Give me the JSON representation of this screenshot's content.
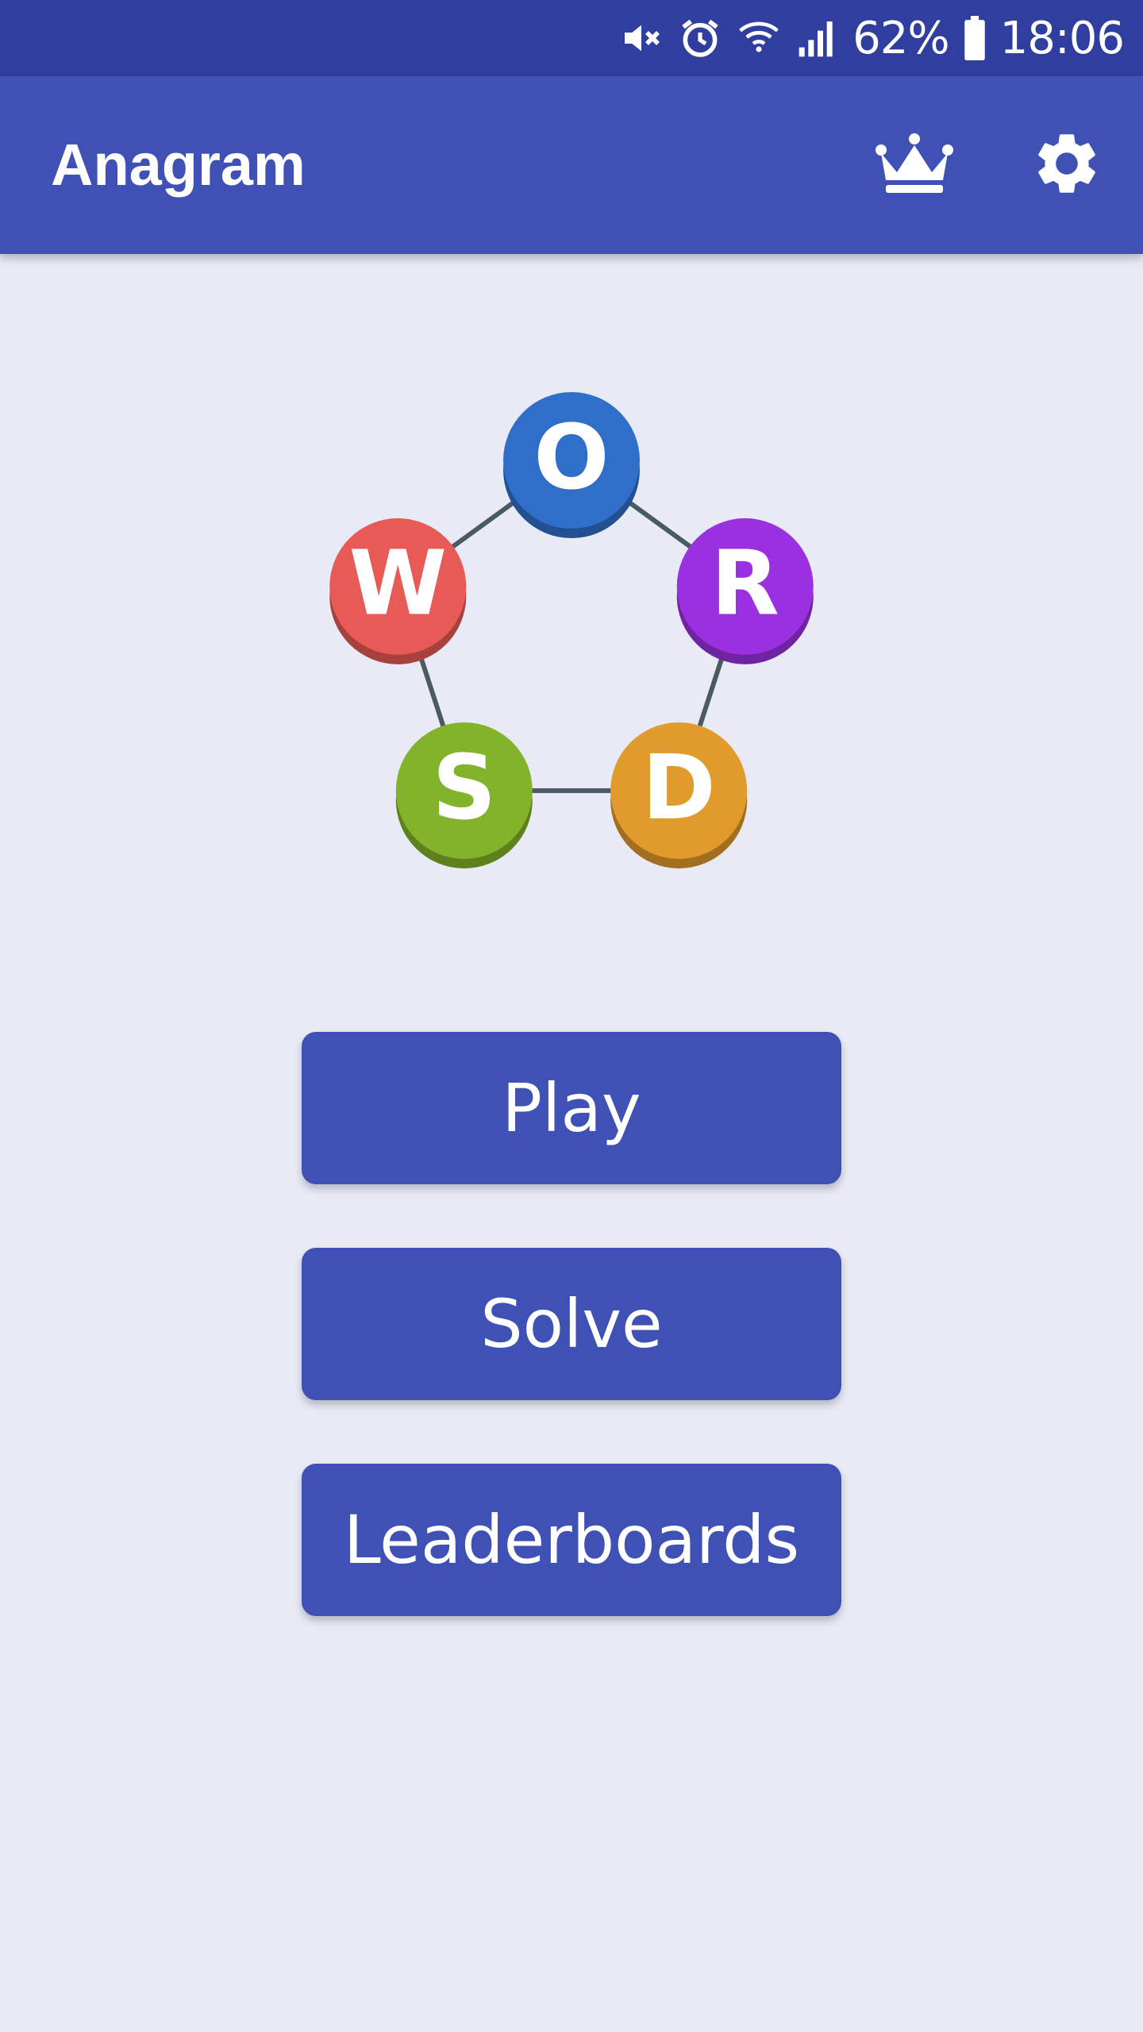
{
  "status_bar": {
    "battery": "62%",
    "time": "18:06",
    "icons": [
      "mute-icon",
      "alarm-icon",
      "wifi-icon",
      "signal-icon",
      "battery-icon"
    ]
  },
  "app_bar": {
    "title": "Anagram",
    "actions": [
      "crown-icon",
      "gear-icon"
    ]
  },
  "logo": {
    "letters": [
      {
        "letter": "O",
        "color": "#2f6fca"
      },
      {
        "letter": "R",
        "color": "#9b30e0"
      },
      {
        "letter": "D",
        "color": "#e19a2c"
      },
      {
        "letter": "S",
        "color": "#83b32a"
      },
      {
        "letter": "W",
        "color": "#e75a55"
      }
    ]
  },
  "menu": {
    "play_label": "Play",
    "solve_label": "Solve",
    "leaderboards_label": "Leaderboards"
  },
  "colors": {
    "primary": "#3f51b5",
    "primary_dark": "#303f9f",
    "background": "#e8eaf6"
  }
}
